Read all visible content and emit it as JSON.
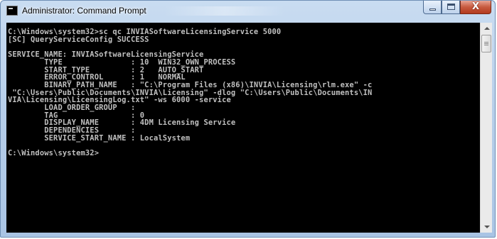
{
  "window": {
    "title": "Administrator: Command Prompt",
    "controls": {
      "close_glyph": "X"
    }
  },
  "console": {
    "lines": [
      "C:\\Windows\\system32>sc qc INVIASoftwareLicensingService 5000",
      "[SC] QueryServiceConfig SUCCESS",
      "",
      "SERVICE_NAME: INVIASoftwareLicensingService",
      "        TYPE               : 10  WIN32_OWN_PROCESS",
      "        START_TYPE         : 2   AUTO_START",
      "        ERROR_CONTROL      : 1   NORMAL",
      "        BINARY_PATH_NAME   : \"C:\\Program Files (x86)\\INVIA\\Licensing\\rlm.exe\" -c",
      " \"C:\\Users\\Public\\Documents\\INVIA\\Licensing\" -dlog \"C:\\Users\\Public\\Documents\\IN",
      "VIA\\Licensing\\LicensingLog.txt\" -ws 6000 -service",
      "        LOAD_ORDER_GROUP   :",
      "        TAG                : 0",
      "        DISPLAY_NAME       : 4DM Licensing Service",
      "        DEPENDENCIES       :",
      "        SERVICE_START_NAME : LocalSystem",
      "",
      "C:\\Windows\\system32>"
    ]
  },
  "colors": {
    "console_bg": "#000000",
    "console_fg": "#c0c0c0",
    "titlebar": "#b7cfea",
    "close_button": "#c75a3f"
  }
}
